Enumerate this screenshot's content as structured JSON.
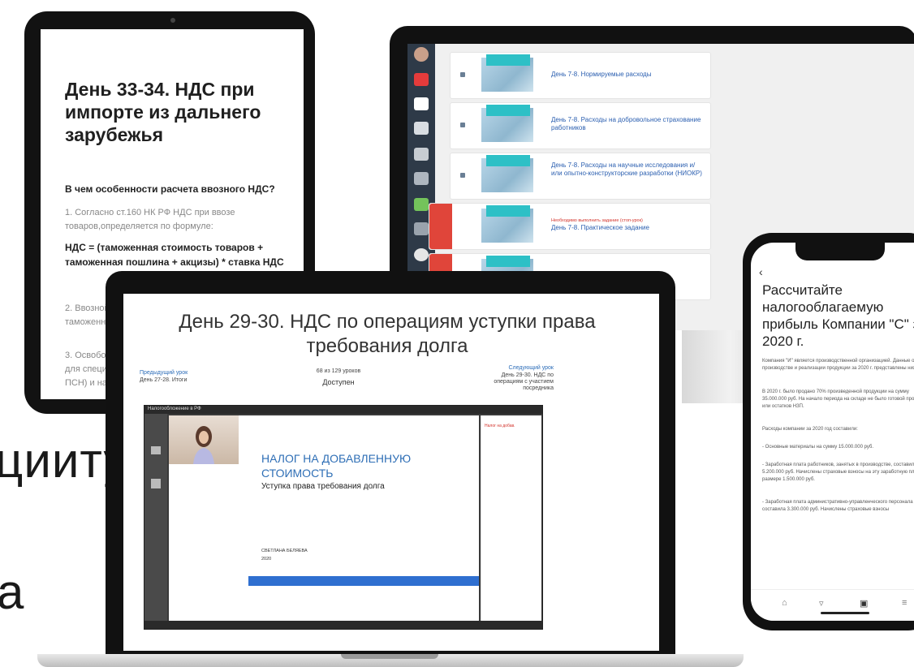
{
  "background": {
    "line1": "цииту.",
    "line2": "а"
  },
  "tablet": {
    "title": "День 33-34. НДС при импорте из дальнего зарубежья",
    "question": "В чем особенности расчета ввозного НДС?",
    "para1": "1. Согласно ст.160 НК РФ НДС при ввозе товаров,определяется по формуле:",
    "formula": "НДС = (таможенная стоимость товаров + таможенная пошлина + акцизы) * ставка НДС",
    "para2": "2. Ввозной",
    "para2b": "таможенно",
    "para3": "3. Освобож",
    "para3b": "для специал",
    "para3c": "ПСН) и на о"
  },
  "monitor": {
    "cards": [
      {
        "title": "День 7-8. Нормируемые расходы",
        "warning": "",
        "locked": false
      },
      {
        "title": "День 7-8. Расходы на добровольное страхование работников",
        "warning": "",
        "locked": false
      },
      {
        "title": "День 7-8. Расходы на научные исследования и/или опытно-конструкторские разработки (НИОКР)",
        "warning": "",
        "locked": false
      },
      {
        "title": "День 7-8. Практическое задание",
        "warning": "Необходимо выполнить задание (стоп-урок)",
        "locked": true
      },
      {
        "title": "",
        "warning": "",
        "locked": true
      }
    ]
  },
  "laptop": {
    "lesson_title": "День 29-30. НДС по операциям уступки права требования долга",
    "prev_label": "Предыдущий урок",
    "prev_value": "День 27-28. Итоги",
    "lesson_count": "68 из 129 уроков",
    "status": "Доступен",
    "next_label": "Следующий урок",
    "next_value": "День 29-30. НДС по операциям с участием посредника",
    "player_title": "Налогообложение в РФ",
    "slide_heading": "НАЛОГ НА ДОБАВЛЕННУЮ СТОИМОСТЬ",
    "slide_subheading": "Уступка права требования долга",
    "author": "СВЕТЛАНА БЕЛЯЕВА",
    "year": "2020",
    "rpanel_item": "Налог на добав."
  },
  "phone": {
    "back_icon": "chevron-left-icon",
    "title": "Рассчитайте налогооблагаемую прибыль Компании \"С\" за 2020 г.",
    "p1": "Компания \"И\" является производственной организацией. Данные о производстве и реализации продукции за 2020 г. представлены ниже.",
    "p2": "В 2020 г. было продано 70% произведенной продукции на сумму 35.000.000 руб. На начало периода на складе не было готовой продукции или остатков НЗП.",
    "p3": "Расходы компании за 2020 год составили:",
    "p4": "- Основные материалы на сумму 15.000.000 руб.",
    "p5": "- Заработная плата работников, занятых в производстве, составила 5.200.000 руб. Начислены страховые взносы на эту заработную плату в размере 1.500.000 руб.",
    "p6": "- Заработная плата административно-управленческого персонала составила 3.300.000 руб. Начислены страховые взносы"
  },
  "colors": {
    "link_blue": "#2b6cb8",
    "slide_blue": "#2f6fd0",
    "teal": "#2dc0c6",
    "alert_red": "#e0453a",
    "sidebar": "#2e3a48"
  }
}
